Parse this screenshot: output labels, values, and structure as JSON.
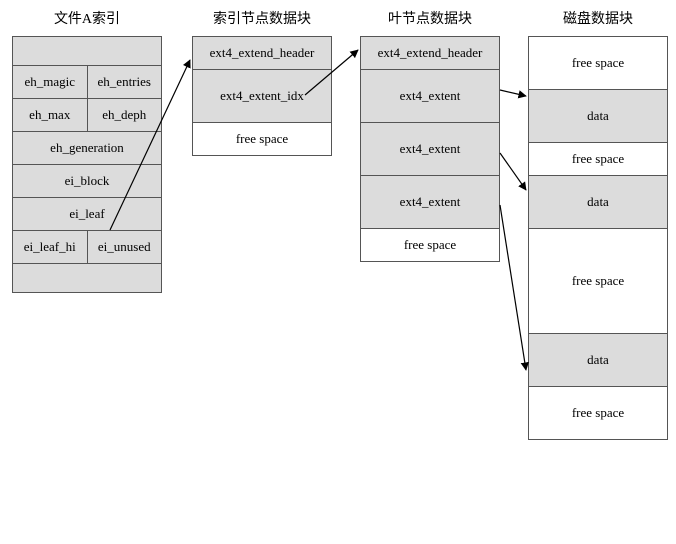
{
  "columns": {
    "fileA": {
      "title": "文件A索引",
      "header_blank": "",
      "eh_magic": "eh_magic",
      "eh_entries": "eh_entries",
      "eh_max": "eh_max",
      "eh_deph": "eh_deph",
      "eh_generation": "eh_generation",
      "ei_block": "ei_block",
      "ei_leaf": "ei_leaf",
      "ei_leaf_hi": "ei_leaf_hi",
      "ei_unused": "ei_unused",
      "footer_blank": ""
    },
    "indexNode": {
      "title": "索引节点数据块",
      "r0": "ext4_extend_header",
      "r1": "ext4_extent_idx",
      "r2": "free space"
    },
    "leafNode": {
      "title": "叶节点数据块",
      "r0": "ext4_extend_header",
      "r1": "ext4_extent",
      "r2": "ext4_extent",
      "r3": "ext4_extent",
      "r4": "free space"
    },
    "disk": {
      "title": "磁盘数据块",
      "r0": "free space",
      "r1": "data",
      "r2": "free space",
      "r3": "data",
      "r4": "free space",
      "r5": "data",
      "r6": "free space"
    }
  }
}
